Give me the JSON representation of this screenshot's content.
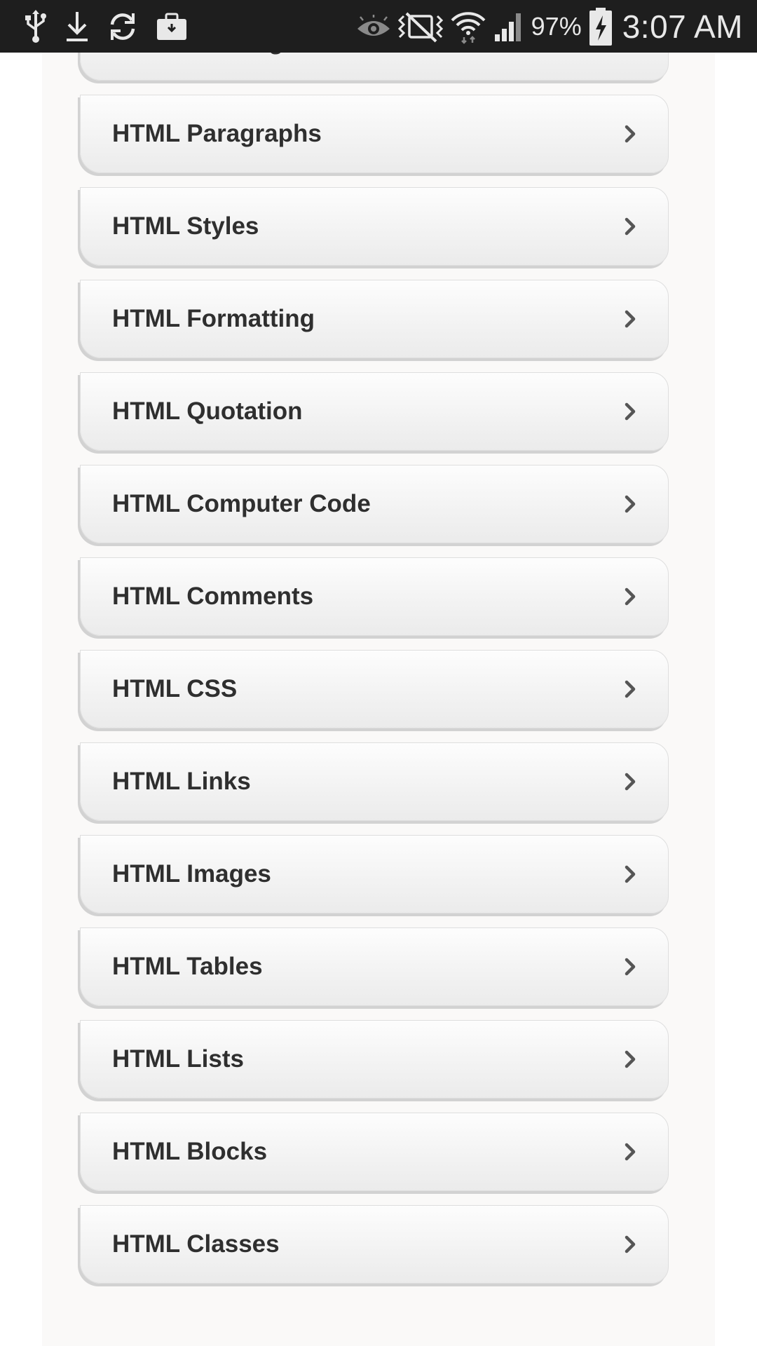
{
  "status_bar": {
    "left_icons": [
      "usb-icon",
      "download-icon",
      "sync-icon",
      "briefcase-icon"
    ],
    "right_icons": [
      "eye-icon",
      "vibrate-icon",
      "wifi-icon",
      "signal-icon",
      "battery-charging-icon"
    ],
    "battery_percent": "97%",
    "time": "3:07 AM"
  },
  "list": {
    "items": [
      {
        "label": "HTML Headings"
      },
      {
        "label": "HTML Paragraphs"
      },
      {
        "label": "HTML Styles"
      },
      {
        "label": "HTML Formatting"
      },
      {
        "label": "HTML Quotation"
      },
      {
        "label": "HTML Computer Code"
      },
      {
        "label": "HTML Comments"
      },
      {
        "label": "HTML CSS"
      },
      {
        "label": "HTML Links"
      },
      {
        "label": "HTML Images"
      },
      {
        "label": "HTML Tables"
      },
      {
        "label": "HTML Lists"
      },
      {
        "label": "HTML Blocks"
      },
      {
        "label": "HTML Classes"
      }
    ],
    "chevron_icon": "chevron-right-icon"
  },
  "colors": {
    "status_bar_bg": "#1e1e1e",
    "status_bar_fg": "#e8e8e8",
    "content_bg": "#faf9f8",
    "item_text": "#2f2f2f",
    "chevron": "#555555"
  }
}
